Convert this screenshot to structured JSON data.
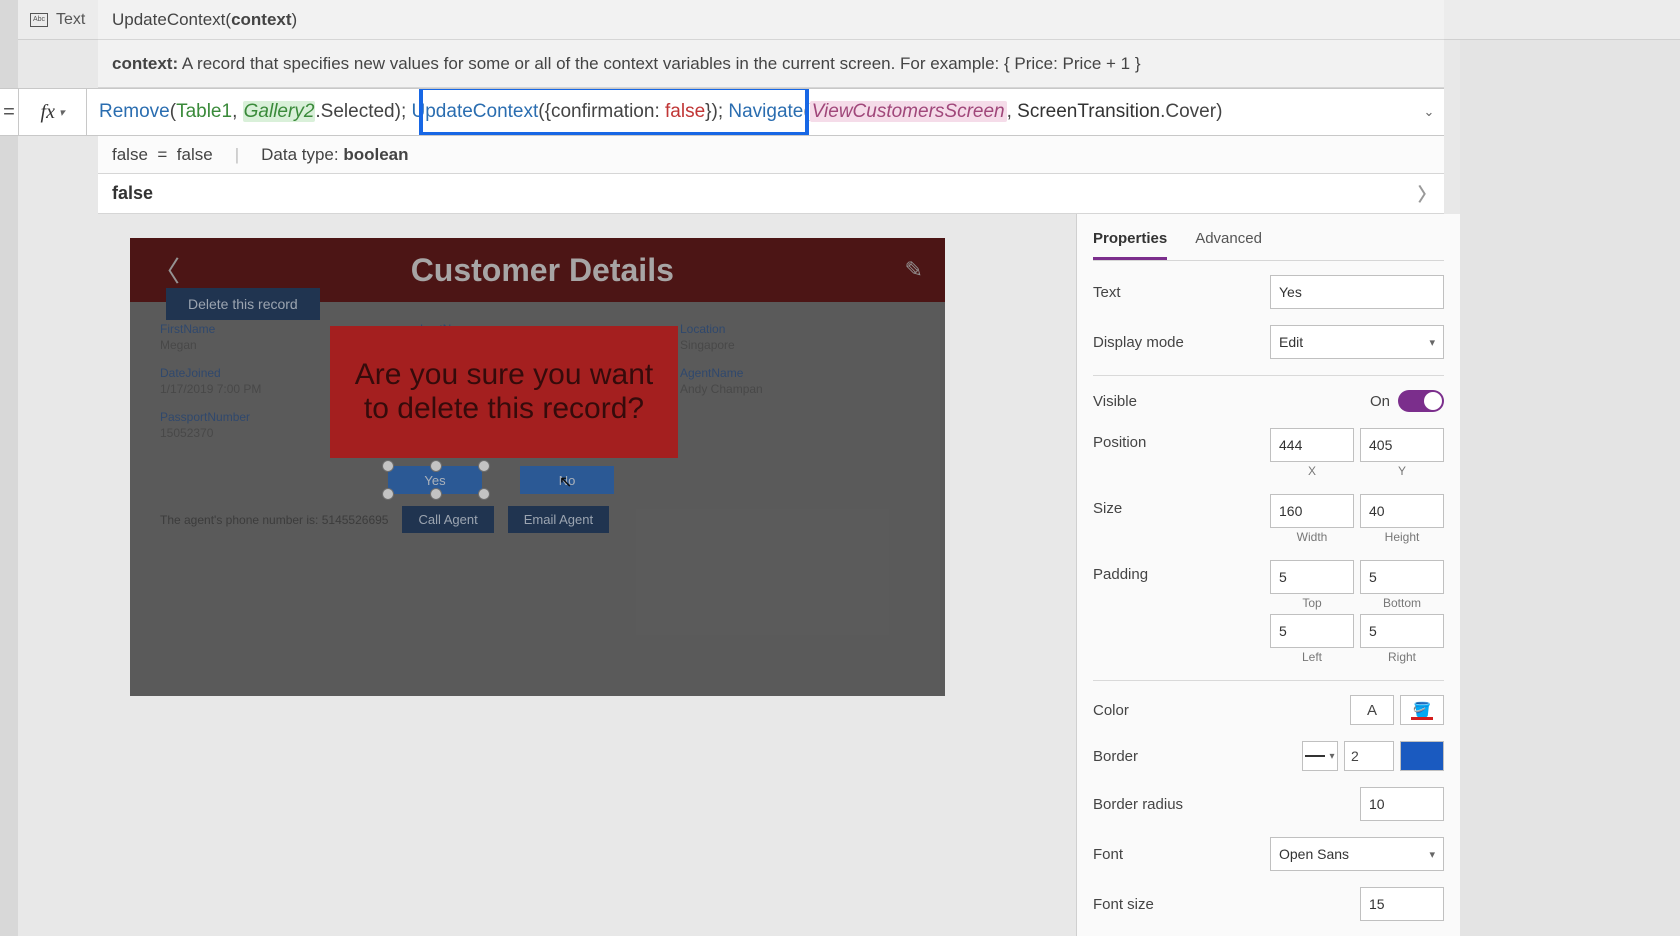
{
  "prop_selector": {
    "mode_label": "Text"
  },
  "hint": {
    "fn_name": "UpdateContext",
    "fn_arg": "context"
  },
  "help": {
    "prefix": "context:",
    "body": " A record that specifies new values for some or all of the context variables in the current screen. For example: { Price: Price + 1 }"
  },
  "formula": {
    "parts": {
      "remove": "Remove",
      "open": "(",
      "table": "Table1",
      "comma": ", ",
      "gallery": "Gallery2",
      "dot": ".",
      "selected": "Selected",
      "close_sc": "); ",
      "update": "UpdateContext",
      "rec_open": "({",
      "rec_key": "confirmation: ",
      "rec_val": "false",
      "rec_close": "}); ",
      "navigate": "Navigate",
      "screen": "ViewCustomersScreen",
      "trans_type": "ScreenTransition",
      "trans_val": "Cover",
      "final_close": ")"
    }
  },
  "result_bar": {
    "lhs": "false",
    "eq": "=",
    "rhs": "false",
    "datatype_label": "Data type: ",
    "datatype_value": "boolean"
  },
  "value_preview": "false",
  "canvas": {
    "title": "Customer Details",
    "fields": {
      "firstname_lbl": "FirstName",
      "firstname_val": "Megan",
      "lastname_lbl": "LastName",
      "location_lbl": "Location",
      "location_val": "Singapore",
      "datejoined_lbl": "DateJoined",
      "datejoined_val": "1/17/2019 7:00 PM",
      "agentname_lbl": "AgentName",
      "agentname_val": "Andy Champan",
      "passport_lbl": "PassportNumber",
      "passport_val": "15052370"
    },
    "confirm_text": "Are you sure you want to delete this record?",
    "yes": "Yes",
    "no": "No",
    "agent_line": "The agent's phone number is:  5145526695",
    "call_agent": "Call Agent",
    "email_agent": "Email Agent",
    "delete": "Delete this record"
  },
  "panel": {
    "tab_properties": "Properties",
    "tab_advanced": "Advanced",
    "text_label": "Text",
    "text_value": "Yes",
    "display_label": "Display mode",
    "display_value": "Edit",
    "visible_label": "Visible",
    "visible_value": "On",
    "position_label": "Position",
    "pos_x": "444",
    "pos_y": "405",
    "pos_x_lbl": "X",
    "pos_y_lbl": "Y",
    "size_label": "Size",
    "size_w": "160",
    "size_h": "40",
    "size_w_lbl": "Width",
    "size_h_lbl": "Height",
    "padding_label": "Padding",
    "pad_t": "5",
    "pad_b": "5",
    "pad_l": "5",
    "pad_r": "5",
    "pad_t_lbl": "Top",
    "pad_b_lbl": "Bottom",
    "pad_l_lbl": "Left",
    "pad_r_lbl": "Right",
    "color_label": "Color",
    "border_label": "Border",
    "border_width": "2",
    "radius_label": "Border radius",
    "radius_value": "10",
    "font_label": "Font",
    "font_value": "Open Sans",
    "fontsize_label": "Font size",
    "fontsize_value": "15"
  }
}
